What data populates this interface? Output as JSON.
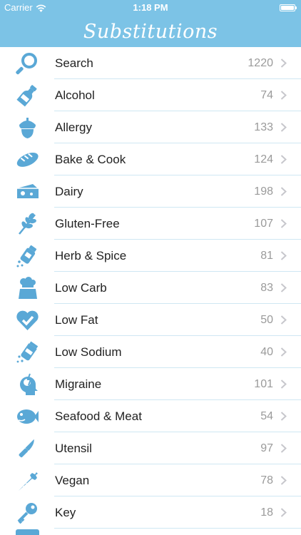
{
  "status": {
    "carrier": "Carrier",
    "time": "1:18 PM"
  },
  "title": "Substitutions",
  "colors": {
    "header": "#7cc3e6",
    "icon": "#5aa8d6"
  },
  "items": [
    {
      "label": "Search",
      "count": "1220",
      "icon": "search-icon"
    },
    {
      "label": "Alcohol",
      "count": "74",
      "icon": "bottle-icon"
    },
    {
      "label": "Allergy",
      "count": "133",
      "icon": "acorn-icon"
    },
    {
      "label": "Bake & Cook",
      "count": "124",
      "icon": "bread-icon"
    },
    {
      "label": "Dairy",
      "count": "198",
      "icon": "cheese-icon"
    },
    {
      "label": "Gluten-Free",
      "count": "107",
      "icon": "wheat-icon"
    },
    {
      "label": "Herb & Spice",
      "count": "81",
      "icon": "spice-shaker-icon"
    },
    {
      "label": "Low Carb",
      "count": "83",
      "icon": "chef-icon"
    },
    {
      "label": "Low Fat",
      "count": "50",
      "icon": "heart-check-icon"
    },
    {
      "label": "Low Sodium",
      "count": "40",
      "icon": "salt-shaker-icon"
    },
    {
      "label": "Migraine",
      "count": "101",
      "icon": "migraine-head-icon"
    },
    {
      "label": "Seafood & Meat",
      "count": "54",
      "icon": "fish-icon"
    },
    {
      "label": "Utensil",
      "count": "97",
      "icon": "knife-icon"
    },
    {
      "label": "Vegan",
      "count": "78",
      "icon": "carrot-icon"
    },
    {
      "label": "Key",
      "count": "18",
      "icon": "key-icon"
    }
  ]
}
